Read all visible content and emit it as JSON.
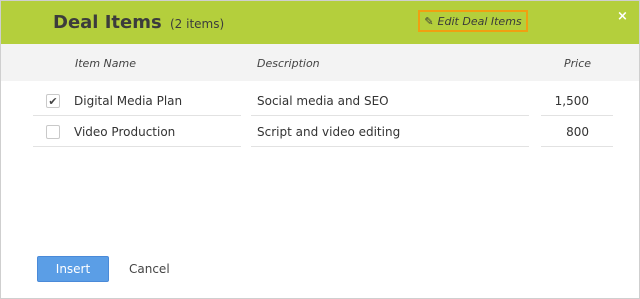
{
  "header": {
    "title": "Deal Items",
    "count": "(2 items)",
    "edit_label": "Edit Deal Items",
    "close_label": "×",
    "edit_icon": "pencil-icon",
    "accent_color": "#b4cf3c",
    "highlight_color": "#f0a011"
  },
  "table": {
    "columns": {
      "item_name": "Item Name",
      "description": "Description",
      "price": "Price"
    },
    "rows": [
      {
        "checked": true,
        "check_mark": "✔",
        "name": "Digital Media Plan",
        "description": "Social media and SEO",
        "price": "1,500"
      },
      {
        "checked": false,
        "check_mark": "",
        "name": "Video Production",
        "description": "Script and video editing",
        "price": "800"
      }
    ]
  },
  "footer": {
    "insert_label": "Insert",
    "cancel_label": "Cancel",
    "insert_color": "#5b9ee6"
  }
}
